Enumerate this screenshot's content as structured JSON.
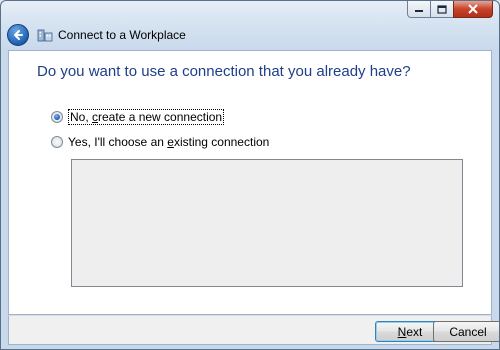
{
  "window": {
    "title": "Connect to a Workplace",
    "caption_buttons": [
      "minimize-icon",
      "maximize-icon",
      "close-icon"
    ]
  },
  "page": {
    "heading": "Do you want to use a connection that you already have?",
    "options": [
      {
        "label_before": "No, ",
        "label_access": "c",
        "label_after": "reate a new connection",
        "checked": true
      },
      {
        "label_before": "Yes, I'll choose an ",
        "label_access": "e",
        "label_after": "xisting connection",
        "checked": false
      }
    ],
    "connections": []
  },
  "footer": {
    "next": {
      "access": "N",
      "rest": "ext"
    },
    "cancel": "Cancel"
  },
  "colors": {
    "heading": "#1e3f8a",
    "close_button": "#c7432b",
    "list_background": "#eeeeee"
  }
}
